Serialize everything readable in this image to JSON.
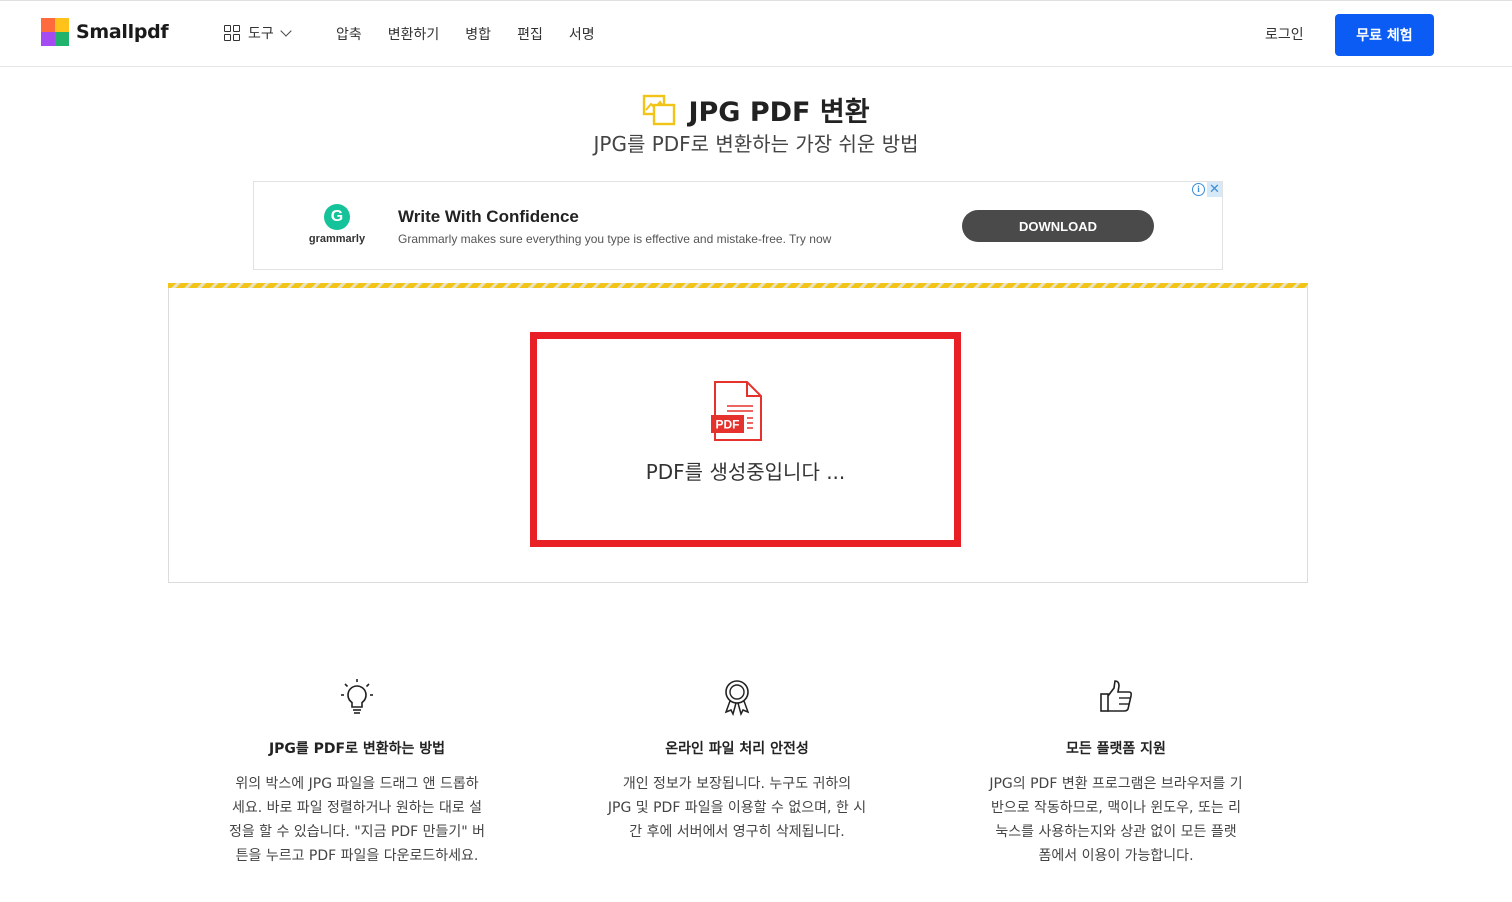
{
  "header": {
    "logo_text": "Smallpdf",
    "tools_label": "도구",
    "nav": [
      "압축",
      "변환하기",
      "병합",
      "편집",
      "서명"
    ],
    "login_label": "로그인",
    "trial_label": "무료 체험"
  },
  "hero": {
    "title": "JPG PDF 변환",
    "subtitle": "JPG를 PDF로 변환하는 가장 쉬운 방법"
  },
  "ad": {
    "brand": "grammarly",
    "brand_initial": "G",
    "headline": "Write With Confidence",
    "body": "Grammarly makes sure everything you type is effective and mistake-free. Try now",
    "cta": "DOWNLOAD",
    "info": "i",
    "close": "✕"
  },
  "converter": {
    "pdf_badge": "PDF",
    "status": "PDF를 생성중입니다 ..."
  },
  "features": [
    {
      "icon": "lightbulb-icon",
      "title": "JPG를 PDF로 변환하는 방법",
      "lines": [
        "위의 박스에 JPG 파일을 드래그 앤 드롭하",
        "세요. 바로 파일 정렬하거나 원하는 대로 설",
        "정을 할 수 있습니다. \"지금 PDF 만들기\" 버",
        "튼을 누르고 PDF 파일을 다운로드하세요."
      ]
    },
    {
      "icon": "award-ribbon-icon",
      "title": "온라인 파일 처리 안전성",
      "lines": [
        "개인 정보가 보장됩니다. 누구도 귀하의",
        "JPG 및 PDF 파일을 이용할 수 없으며, 한 시",
        "간 후에 서버에서 영구히 삭제됩니다."
      ]
    },
    {
      "icon": "thumbs-up-icon",
      "title": "모든 플랫폼 지원",
      "lines": [
        "JPG의 PDF 변환 프로그램은 브라우저를 기",
        "반으로 작동하므로, 맥이나 윈도우, 또는 리",
        "눅스를 사용하는지와 상관 없이 모든 플랫",
        "폼에서 이용이 가능합니다."
      ]
    }
  ],
  "colors": {
    "brand_blue": "#0a5cf5",
    "highlight_red": "#e81f25",
    "pdf_red": "#e5322d",
    "stripe_yellow": "#f2c417"
  }
}
